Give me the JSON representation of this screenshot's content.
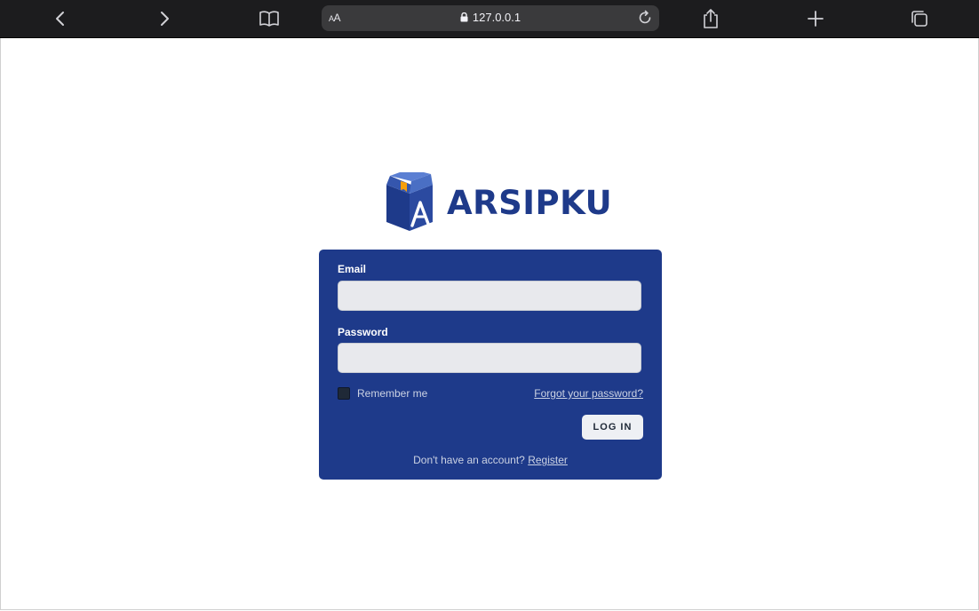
{
  "browser": {
    "url_text_size": "AA",
    "url_host": "127.0.0.1"
  },
  "brand": {
    "name": "ARSIPKU",
    "color": "#1e3a8a",
    "icon": "archive-box-logo"
  },
  "login_form": {
    "email_label": "Email",
    "email_value": "",
    "password_label": "Password",
    "password_value": "",
    "remember_label": "Remember me",
    "remember_checked": false,
    "forgot_link": "Forgot your password?",
    "submit_label": "LOG IN",
    "register_prompt": "Don't have an account?",
    "register_link": "Register"
  },
  "icons": {
    "back": "chevron-left-icon",
    "forward": "chevron-right-icon",
    "bookmarks": "book-icon",
    "lock": "lock-icon",
    "reload": "reload-icon",
    "share": "share-icon",
    "new_tab": "plus-icon",
    "tabs": "tabs-icon"
  }
}
